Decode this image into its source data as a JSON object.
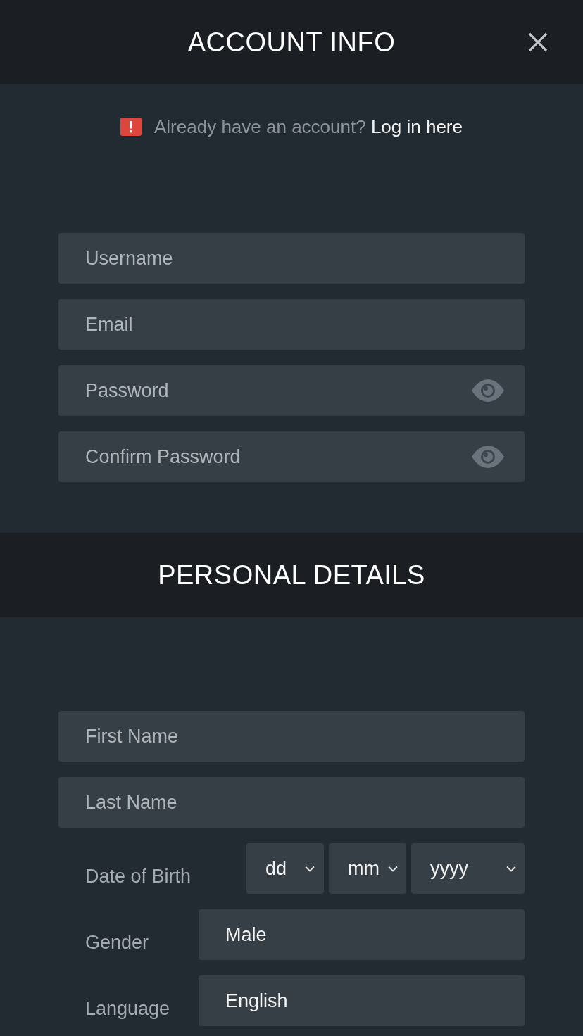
{
  "header": {
    "title": "ACCOUNT INFO"
  },
  "notice": {
    "text": "Already have an account?",
    "link": "Log in here"
  },
  "account_fields": [
    {
      "kind": "text",
      "placeholder": "Username"
    },
    {
      "kind": "text",
      "placeholder": "Email"
    },
    {
      "kind": "password",
      "placeholder": "Password"
    },
    {
      "kind": "password",
      "placeholder": "Confirm Password"
    }
  ],
  "personal_section": {
    "title": "PERSONAL DETAILS"
  },
  "personal_fields": [
    {
      "kind": "text",
      "placeholder": "First Name"
    },
    {
      "kind": "text",
      "placeholder": "Last Name"
    },
    {
      "kind": "date",
      "label": "Date of Birth",
      "selects": [
        {
          "value": "dd"
        },
        {
          "value": "mm"
        },
        {
          "value": "yyyy"
        }
      ]
    },
    {
      "kind": "select",
      "label": "Gender",
      "value": "Male"
    },
    {
      "kind": "select",
      "label": "Language",
      "value": "English"
    }
  ]
}
